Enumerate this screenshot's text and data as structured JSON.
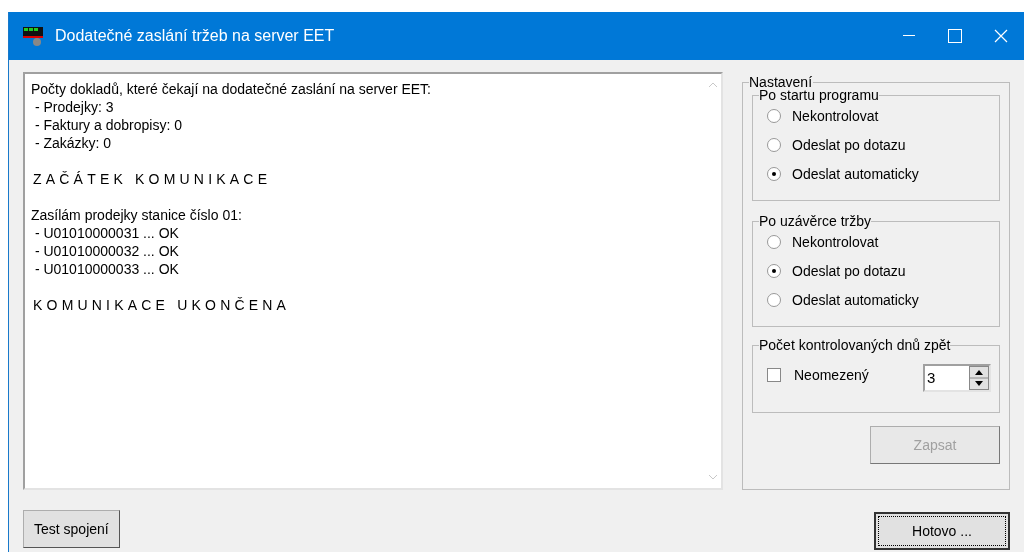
{
  "window": {
    "title": "Dodatečné zaslání tržeb na server EET"
  },
  "log": {
    "paragraphs": [
      {
        "kind": "text",
        "lines": [
          "Počty dokladů, které čekají na dodatečné zaslání na server EET:",
          " - Prodejky: 3",
          " - Faktury a dobropisy: 0",
          " - Zakázky: 0"
        ]
      },
      {
        "kind": "heading",
        "lines": [
          "ZAČÁTEK KOMUNIKACE"
        ]
      },
      {
        "kind": "text",
        "lines": [
          "Zasílám prodejky stanice číslo 01:",
          " - U01010000031 ... OK",
          " - U01010000032 ... OK",
          " - U01010000033 ... OK"
        ]
      },
      {
        "kind": "heading",
        "lines": [
          "KOMUNIKACE UKONČENA"
        ]
      }
    ]
  },
  "settings": {
    "title": "Nastavení",
    "groups": [
      {
        "title": "Po startu programu",
        "options": [
          {
            "label": "Nekontrolovat",
            "selected": false
          },
          {
            "label": "Odeslat po dotazu",
            "selected": false
          },
          {
            "label": "Odeslat automaticky",
            "selected": true
          }
        ]
      },
      {
        "title": "Po uzávěrce tržby",
        "options": [
          {
            "label": "Nekontrolovat",
            "selected": false
          },
          {
            "label": "Odeslat po dotazu",
            "selected": true
          },
          {
            "label": "Odeslat automaticky",
            "selected": false
          }
        ]
      }
    ],
    "days": {
      "title": "Počet kontrolovaných dnů zpět",
      "unlimited": {
        "label": "Neomezený",
        "checked": false
      },
      "value": "3"
    },
    "save_button": {
      "label": "Zapsat",
      "disabled": true
    }
  },
  "buttons": {
    "test": "Test spojení",
    "done": "Hotovo ..."
  }
}
